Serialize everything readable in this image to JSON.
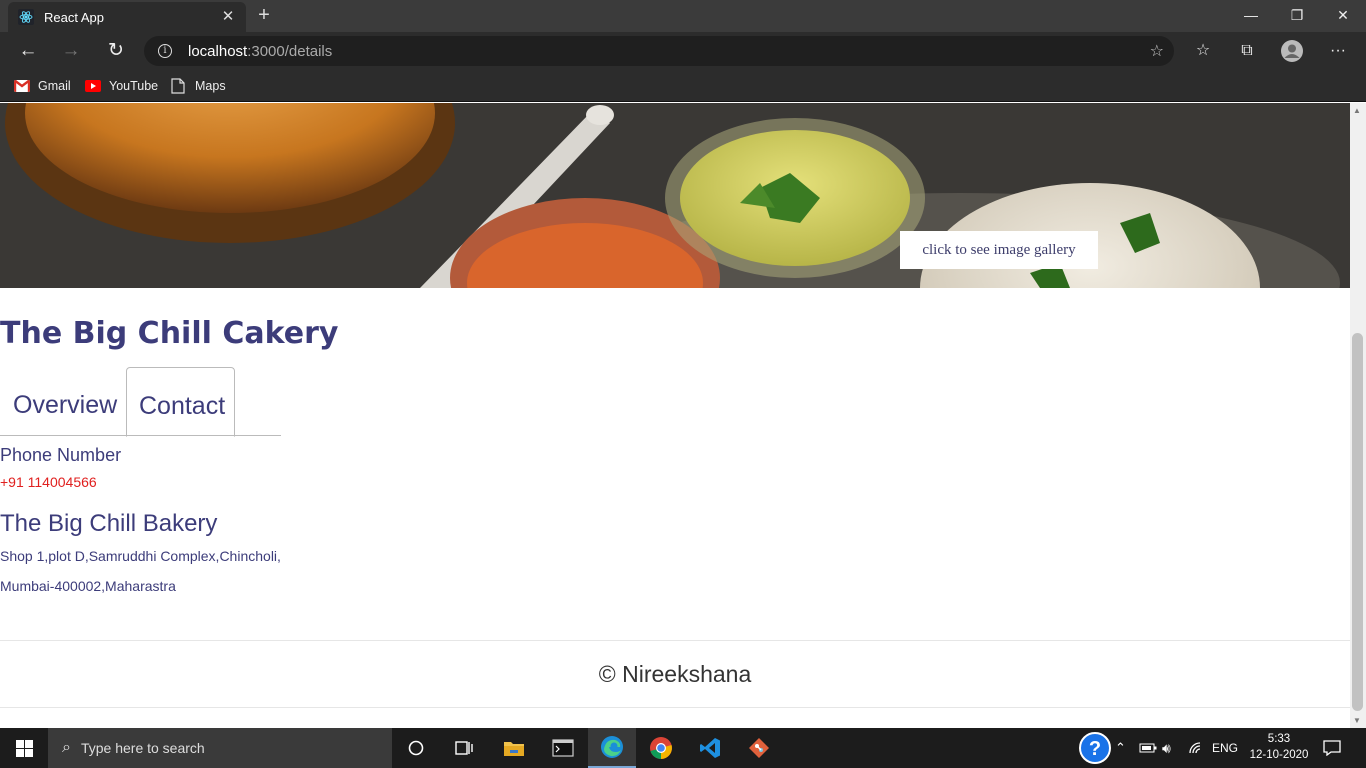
{
  "browser": {
    "tab_title": "React App",
    "url_host": "localhost",
    "url_path": ":3000/details",
    "bookmarks": [
      {
        "label": "Gmail",
        "icon": "gmail-icon",
        "color": "#ffffff"
      },
      {
        "label": "YouTube",
        "icon": "youtube-icon",
        "color": "#ff0000"
      },
      {
        "label": "Maps",
        "icon": "page-icon",
        "color": "#cccccc"
      }
    ]
  },
  "page": {
    "gallery_button": "click to see image gallery",
    "restaurant_name": "The Big Chill Cakery",
    "tabs": [
      "Overview",
      "Contact"
    ],
    "active_tab": "Contact",
    "phone_label": "Phone Number",
    "phone_value": "+91 114004566",
    "branch_name": "The Big Chill Bakery",
    "address_line1": "Shop 1,plot D,Samruddhi Complex,Chincholi,",
    "address_line2": "Mumbai-400002,Maharastra",
    "footer": "© Nireekshana"
  },
  "taskbar": {
    "search_placeholder": "Type here to search",
    "language": "ENG",
    "time": "5:33",
    "date": "12-10-2020"
  },
  "colors": {
    "accent": "#3c3c7a",
    "phone": "#e0201f",
    "browser_dark": "#2c2c2c"
  }
}
